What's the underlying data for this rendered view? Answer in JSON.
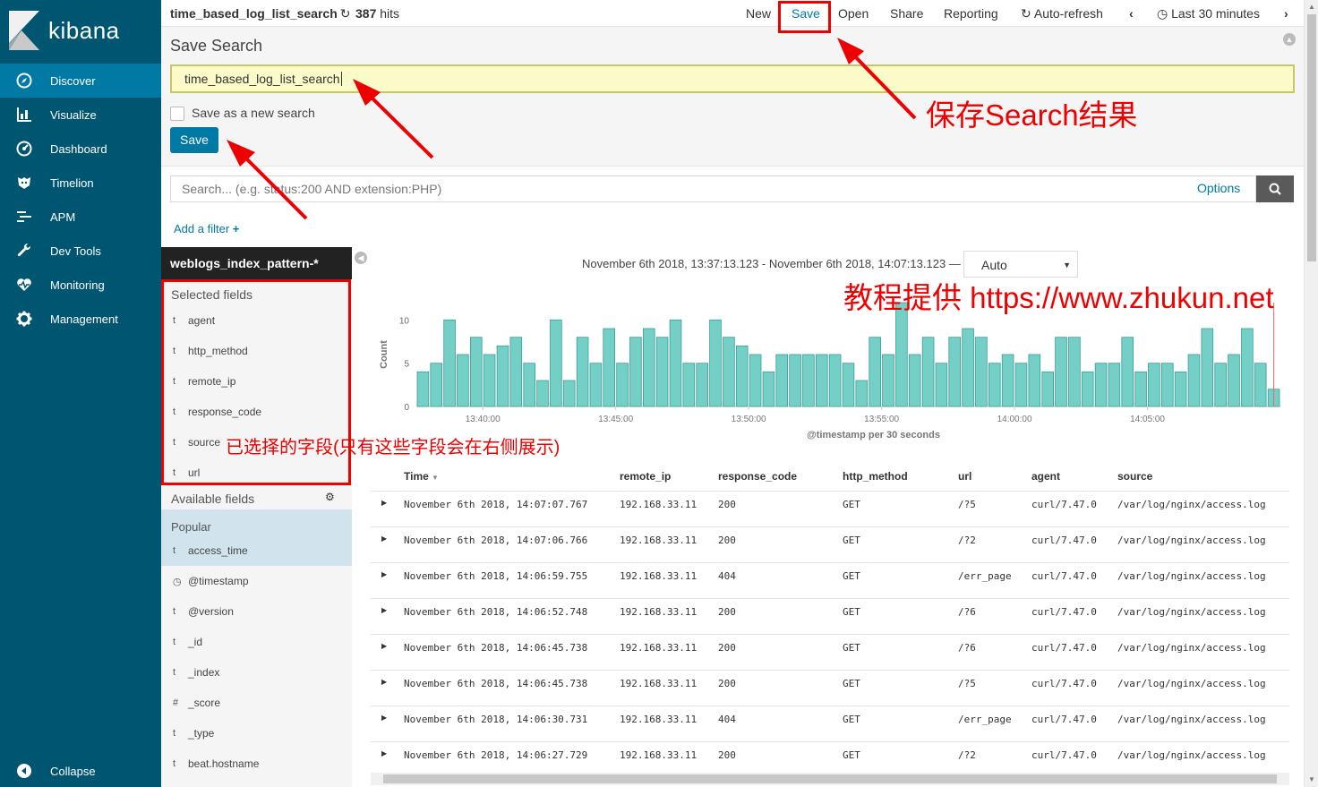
{
  "app": {
    "logo_text": "kibana"
  },
  "sidebar": {
    "items": [
      {
        "label": "Discover",
        "icon": "compass-icon"
      },
      {
        "label": "Visualize",
        "icon": "bar-chart-icon"
      },
      {
        "label": "Dashboard",
        "icon": "dashboard-icon"
      },
      {
        "label": "Timelion",
        "icon": "timelion-icon"
      },
      {
        "label": "APM",
        "icon": "apm-icon"
      },
      {
        "label": "Dev Tools",
        "icon": "wrench-icon"
      },
      {
        "label": "Monitoring",
        "icon": "heartbeat-icon"
      },
      {
        "label": "Management",
        "icon": "gear-icon"
      }
    ],
    "collapse_label": "Collapse"
  },
  "topbar": {
    "title": "time_based_log_list_search",
    "hits_count": "387",
    "hits_label": "hits",
    "menu": {
      "new": "New",
      "save": "Save",
      "open": "Open",
      "share": "Share",
      "reporting": "Reporting",
      "auto_refresh": "Auto-refresh",
      "time": "Last 30 minutes"
    }
  },
  "save_panel": {
    "heading": "Save Search",
    "input_value": "time_based_log_list_search",
    "checkbox_label": "Save as a new search",
    "save_button": "Save"
  },
  "search": {
    "placeholder": "Search... (e.g. status:200 AND extension:PHP)",
    "options_label": "Options",
    "add_filter": "Add a filter"
  },
  "fields": {
    "index_pattern": "weblogs_index_pattern-*",
    "selected_heading": "Selected fields",
    "selected": [
      {
        "type": "t",
        "name": "agent"
      },
      {
        "type": "t",
        "name": "http_method"
      },
      {
        "type": "t",
        "name": "remote_ip"
      },
      {
        "type": "t",
        "name": "response_code"
      },
      {
        "type": "t",
        "name": "source"
      },
      {
        "type": "t",
        "name": "url"
      }
    ],
    "available_heading": "Available fields",
    "popular_heading": "Popular",
    "popular": [
      {
        "type": "t",
        "name": "access_time"
      }
    ],
    "available": [
      {
        "type": "◷",
        "name": "@timestamp"
      },
      {
        "type": "t",
        "name": "@version"
      },
      {
        "type": "t",
        "name": "_id"
      },
      {
        "type": "t",
        "name": "_index"
      },
      {
        "type": "#",
        "name": "_score"
      },
      {
        "type": "t",
        "name": "_type"
      },
      {
        "type": "t",
        "name": "beat.hostname"
      }
    ]
  },
  "histogram": {
    "time_range": "November 6th 2018, 13:37:13.123 - November 6th 2018, 14:07:13.123 —",
    "interval": "Auto"
  },
  "chart_data": {
    "type": "bar",
    "ylabel": "Count",
    "xlabel": "@timestamp per 30 seconds",
    "bar_color": "#74cfc7",
    "ylim": [
      0,
      12
    ],
    "yticks": [
      0,
      5,
      10
    ],
    "xticks": [
      "13:40:00",
      "13:45:00",
      "13:50:00",
      "13:55:00",
      "14:00:00",
      "14:05:00"
    ],
    "values": [
      4,
      5,
      10,
      6,
      8,
      6,
      7,
      8,
      5,
      3,
      10,
      3,
      8,
      5,
      9,
      5,
      8,
      9,
      8,
      10,
      5,
      5,
      10,
      8,
      7,
      6,
      4,
      6,
      6,
      6,
      6,
      6,
      5,
      3,
      8,
      6,
      12,
      6,
      8,
      5,
      8,
      9,
      8,
      5,
      6,
      5,
      6,
      4,
      8,
      8,
      4,
      5,
      5,
      8,
      4,
      5,
      5,
      4,
      6,
      9,
      5,
      6,
      9,
      5,
      2
    ]
  },
  "table": {
    "columns": [
      "Time",
      "remote_ip",
      "response_code",
      "http_method",
      "url",
      "agent",
      "source"
    ],
    "rows": [
      [
        "November 6th 2018, 14:07:07.767",
        "192.168.33.11",
        "200",
        "GET",
        "/?5",
        "curl/7.47.0",
        "/var/log/nginx/access.log"
      ],
      [
        "November 6th 2018, 14:07:06.766",
        "192.168.33.11",
        "200",
        "GET",
        "/?2",
        "curl/7.47.0",
        "/var/log/nginx/access.log"
      ],
      [
        "November 6th 2018, 14:06:59.755",
        "192.168.33.11",
        "404",
        "GET",
        "/err_page",
        "curl/7.47.0",
        "/var/log/nginx/access.log"
      ],
      [
        "November 6th 2018, 14:06:52.748",
        "192.168.33.11",
        "200",
        "GET",
        "/?6",
        "curl/7.47.0",
        "/var/log/nginx/access.log"
      ],
      [
        "November 6th 2018, 14:06:45.738",
        "192.168.33.11",
        "200",
        "GET",
        "/?6",
        "curl/7.47.0",
        "/var/log/nginx/access.log"
      ],
      [
        "November 6th 2018, 14:06:45.738",
        "192.168.33.11",
        "200",
        "GET",
        "/?5",
        "curl/7.47.0",
        "/var/log/nginx/access.log"
      ],
      [
        "November 6th 2018, 14:06:30.731",
        "192.168.33.11",
        "404",
        "GET",
        "/err_page",
        "curl/7.47.0",
        "/var/log/nginx/access.log"
      ],
      [
        "November 6th 2018, 14:06:27.729",
        "192.168.33.11",
        "200",
        "GET",
        "/?2",
        "curl/7.47.0",
        "/var/log/nginx/access.log"
      ]
    ]
  },
  "annotations": {
    "save_note": "保存Search结果",
    "tutorial_note": "教程提供 https://www.zhukun.net",
    "selected_note": "已选择的字段(只有这些字段会在右侧展示)"
  }
}
